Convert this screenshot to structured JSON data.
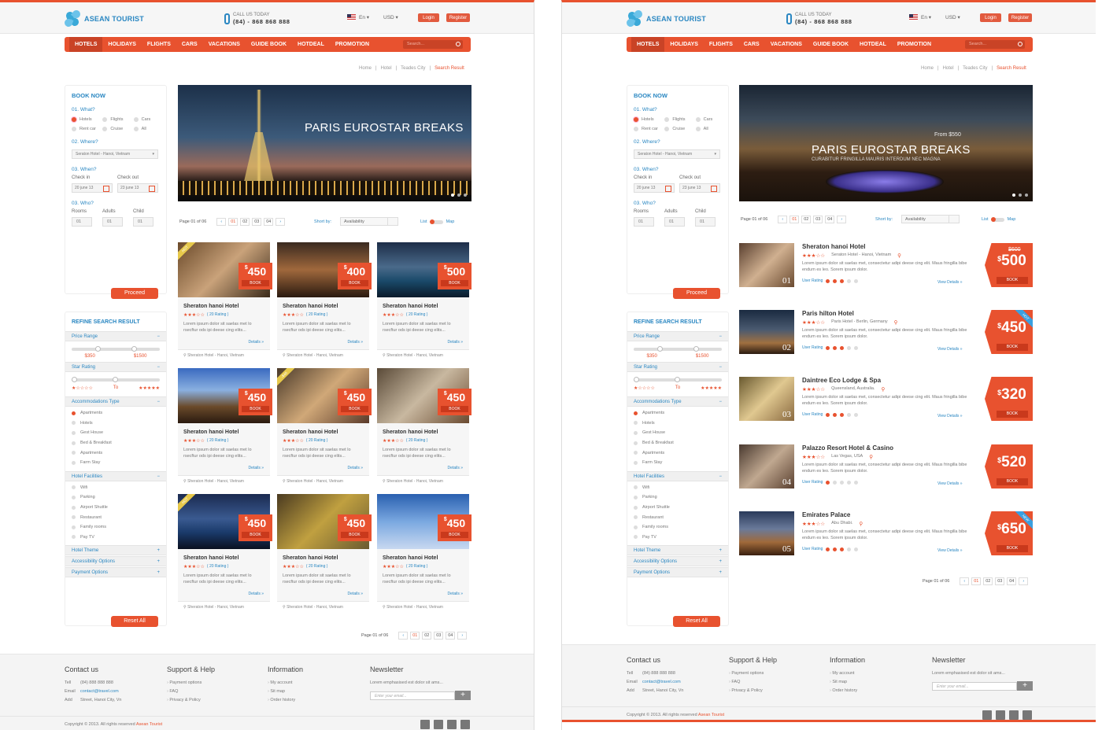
{
  "brand": {
    "name": "ASEAN TOURIST",
    "call_label": "CALL US TODAY",
    "call_number": "(84) - 868 868 888"
  },
  "header": {
    "lang": "En",
    "currency": "USD",
    "login": "Login",
    "register": "Register"
  },
  "nav": {
    "items": [
      "HOTELS",
      "HOLIDAYS",
      "FLIGHTS",
      "CARS",
      "VACATIONS",
      "GUIDE BOOK",
      "HOTDEAL",
      "PROMOTION"
    ],
    "search_placeholder": "Search..."
  },
  "breadcrumb": [
    "Home",
    "Hotel",
    "Teades City",
    "Search Result"
  ],
  "booking": {
    "title": "BOOK NOW",
    "q1": "01. What?",
    "what_options": [
      "Hotels",
      "Flights",
      "Cars",
      "Rent car",
      "Cruise",
      "All"
    ],
    "q2": "02. Where?",
    "where_value": "Seraton Hotel - Hanoi, Vietnam",
    "q3": "03. When?",
    "checkin_label": "Check in",
    "checkout_label": "Check out",
    "checkin_value": "20 june 13",
    "checkout_value": "23 june 13",
    "q4": "03. Who?",
    "rooms_label": "Rooms",
    "adults_label": "Adults",
    "child_label": "Child",
    "rooms_value": "01",
    "adults_value": "01",
    "child_value": "01",
    "proceed": "Proceed"
  },
  "refine": {
    "title": "REFINE SEARCH RESULT",
    "price_range": "Price Range",
    "price_min": "$350",
    "price_max": "$1500",
    "star_rating": "Star Rating",
    "star_to": "To",
    "accom_type": "Accommodations Type",
    "accom_options": [
      "Apartments",
      "Hotels",
      "Gest House",
      "Bed & Breakfast",
      "Apartments",
      "Farm Stay"
    ],
    "facilities": "Hotel Facilities",
    "facility_options": [
      "Wifi",
      "Parking",
      "Airport Shuttle",
      "Restaurant",
      "Family rooms",
      "Pay TV"
    ],
    "hotel_theme": "Hotel Theme",
    "accessibility": "Accessibility Options",
    "payment": "Payment Options",
    "collapse_icon": "−",
    "expand_icon": "+",
    "reset": "Reset All"
  },
  "heroA": {
    "title": "PARIS EUROSTAR BREAKS"
  },
  "heroB": {
    "title": "PARIS EUROSTAR BREAKS",
    "from": "From $550",
    "subtitle": "CURABITUR FRINGILLA MAURIS INTERDUM NEC MAGNA"
  },
  "listing": {
    "page_info": "Page 01 of 06",
    "pages": [
      "01",
      "02",
      "03",
      "04"
    ],
    "sort_label": "Short by:",
    "sort_value": "Availability",
    "view_list": "List",
    "view_map": "Map"
  },
  "grid_cards": [
    {
      "price": "450",
      "badge": "HOT"
    },
    {
      "price": "400",
      "badge": ""
    },
    {
      "price": "500",
      "badge": ""
    },
    {
      "price": "450",
      "badge": ""
    },
    {
      "price": "450",
      "badge": "-$40"
    },
    {
      "price": "450",
      "badge": ""
    },
    {
      "price": "450",
      "badge": "HOT"
    },
    {
      "price": "450",
      "badge": ""
    },
    {
      "price": "450",
      "badge": ""
    }
  ],
  "grid_card_common": {
    "name": "Sheraton hanoi Hotel",
    "rating": "( 20 Rating )",
    "desc": "Lorem ipsum dolor sit saelas met lo rsecftur ods ipi deese cing elits...",
    "details": "Details »",
    "location": "Sheraton Hotel - Hanoi, Vietnam",
    "book": "BOOK",
    "currency": "$"
  },
  "list_rows": [
    {
      "name": "Sheraton hanoi Hotel",
      "location": "Seraton Hotel - Hanoi, Vietnam",
      "price": "500",
      "old_price": "$600",
      "num": "01",
      "badge": "",
      "rating_on": 3
    },
    {
      "name": "Paris hilton Hotel",
      "location": "Paris Hotel - Berlin, Germany",
      "price": "450",
      "old_price": "",
      "num": "02",
      "badge": "HOT",
      "rating_on": 3
    },
    {
      "name": "Daintree Eco Lodge & Spa",
      "location": "Queensland, Australia.",
      "price": "320",
      "old_price": "",
      "num": "03",
      "badge": "",
      "rating_on": 3
    },
    {
      "name": "Palazzo Resort Hotel & Casino",
      "location": "Las Vegas, USA",
      "price": "520",
      "old_price": "",
      "num": "04",
      "badge": "",
      "rating_on": 1
    },
    {
      "name": "Emirates Palace",
      "location": "Abu Dhabi.",
      "price": "650",
      "old_price": "",
      "num": "05",
      "badge": "NEW",
      "rating_on": 3
    }
  ],
  "list_common": {
    "desc": "Lorem ipsum dolor sit saelas met, consectetur adipi deese cing elit. Maus fringilla bibe endum es leo. Sorem ipsum dolor.",
    "user_rating": "User Rating",
    "view_details": "View Details »",
    "book": "BOOK",
    "currency": "$"
  },
  "footer": {
    "contact_title": "Contact us",
    "tel_label": "Tell",
    "tel": "(84) 888 888 888",
    "email_label": "Email",
    "email": "contact@travel.com",
    "add_label": "Add",
    "address": "Street, Hanoi City, Vn",
    "support_title": "Support & Help",
    "support_links": [
      "Payment options",
      "FAQ",
      "Privacy & Policy"
    ],
    "info_title": "Information",
    "info_links": [
      "My account",
      "Sit map",
      "Order history"
    ],
    "newsletter_title": "Newsletter",
    "newsletter_text": "Lorem emphasised est dolor sit ams...",
    "newsletter_placeholder": "Enter your email...",
    "newsletter_btn": "+",
    "copyright": "Copyright © 2013. All rights reserved",
    "copyright_brand": "Asean Tourist"
  },
  "colors": {
    "accent": "#e8522f",
    "link": "#2a87c2"
  }
}
